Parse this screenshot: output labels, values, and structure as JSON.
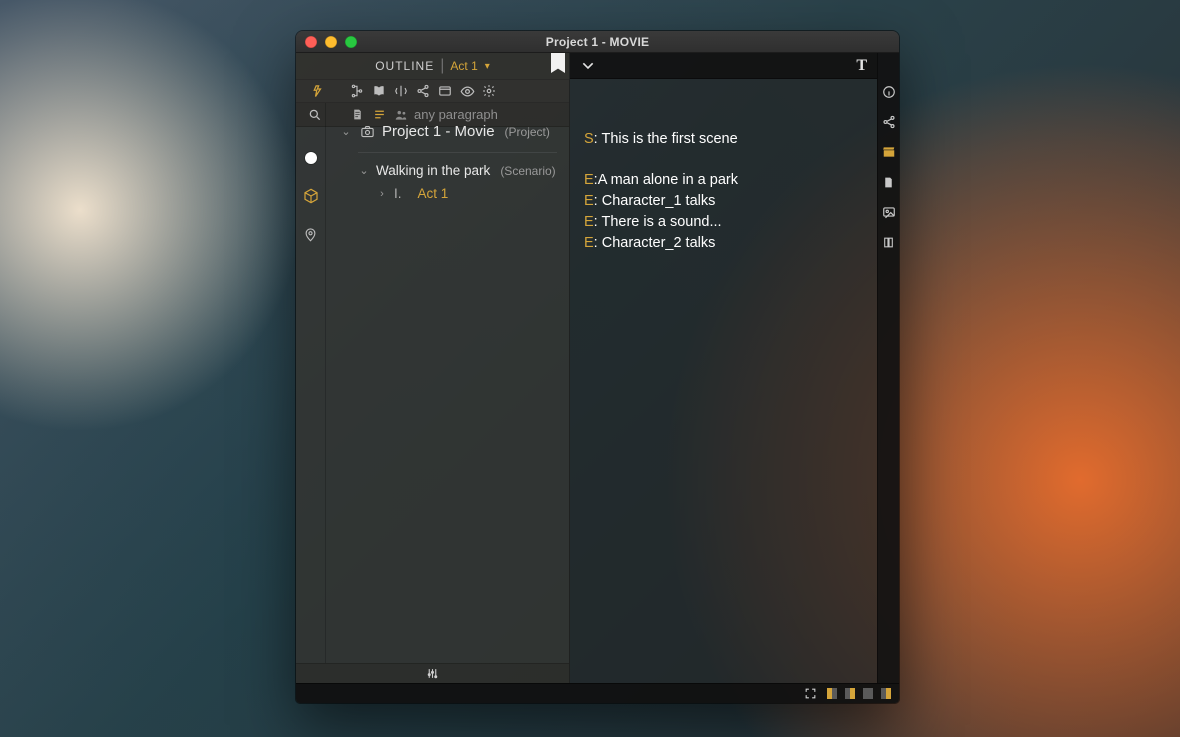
{
  "window": {
    "title": "Project 1 - MOVIE"
  },
  "outline": {
    "header_label": "OUTLINE",
    "header_active": "Act 1",
    "filter_placeholder": "any paragraph",
    "bookmark": "bookmark"
  },
  "tree": {
    "project": {
      "title": "Project 1 - Movie",
      "kind": "(Project)"
    },
    "scenario": {
      "title": "Walking in the park",
      "kind": "(Scenario)"
    },
    "act": {
      "numeral": "I.",
      "title": "Act 1"
    }
  },
  "icons": {
    "run": "run-icon",
    "hierarchy": "hierarchy-icon",
    "book": "book-icon",
    "split": "split-icon",
    "share": "share-icon",
    "card": "card-icon",
    "eye": "eye-icon",
    "settings": "gear-icon",
    "search": "search-icon",
    "page": "page-icon",
    "lines": "lines-icon",
    "people": "people-icon",
    "rail_dot": "marker-dot",
    "rail_cube": "cube-icon",
    "rail_pin": "pin-icon",
    "rail_camera": "camera-icon",
    "rh_chevron": "chevron-down-icon",
    "rh_text": "text-tool-icon",
    "sliders": "sliders-icon",
    "side_info": "info-icon",
    "side_share": "share-icon",
    "side_clapper": "clapperboard-icon",
    "side_page": "page-icon",
    "side_image": "image-icon",
    "side_column": "column-icon",
    "sb_fullscreen": "fullscreen-icon",
    "sb_cols1": "columns-toggle",
    "sb_cols2": "columns-toggle",
    "sb_cols3": "columns-toggle",
    "sb_cols4": "columns-toggle"
  },
  "document": {
    "lines": [
      {
        "prefix": "S",
        "text": "This is the first scene"
      },
      {
        "gap": true
      },
      {
        "prefix": "E",
        "sep": ":",
        "text": "A man alone in a park"
      },
      {
        "prefix": "E",
        "sep": ": ",
        "text": "Character_1 talks"
      },
      {
        "prefix": "E",
        "sep": ": ",
        "text": "There is a sound..."
      },
      {
        "prefix": "E",
        "sep": ": ",
        "text": "Character_2 talks"
      }
    ]
  },
  "colors": {
    "accent": "#d5a53a"
  }
}
